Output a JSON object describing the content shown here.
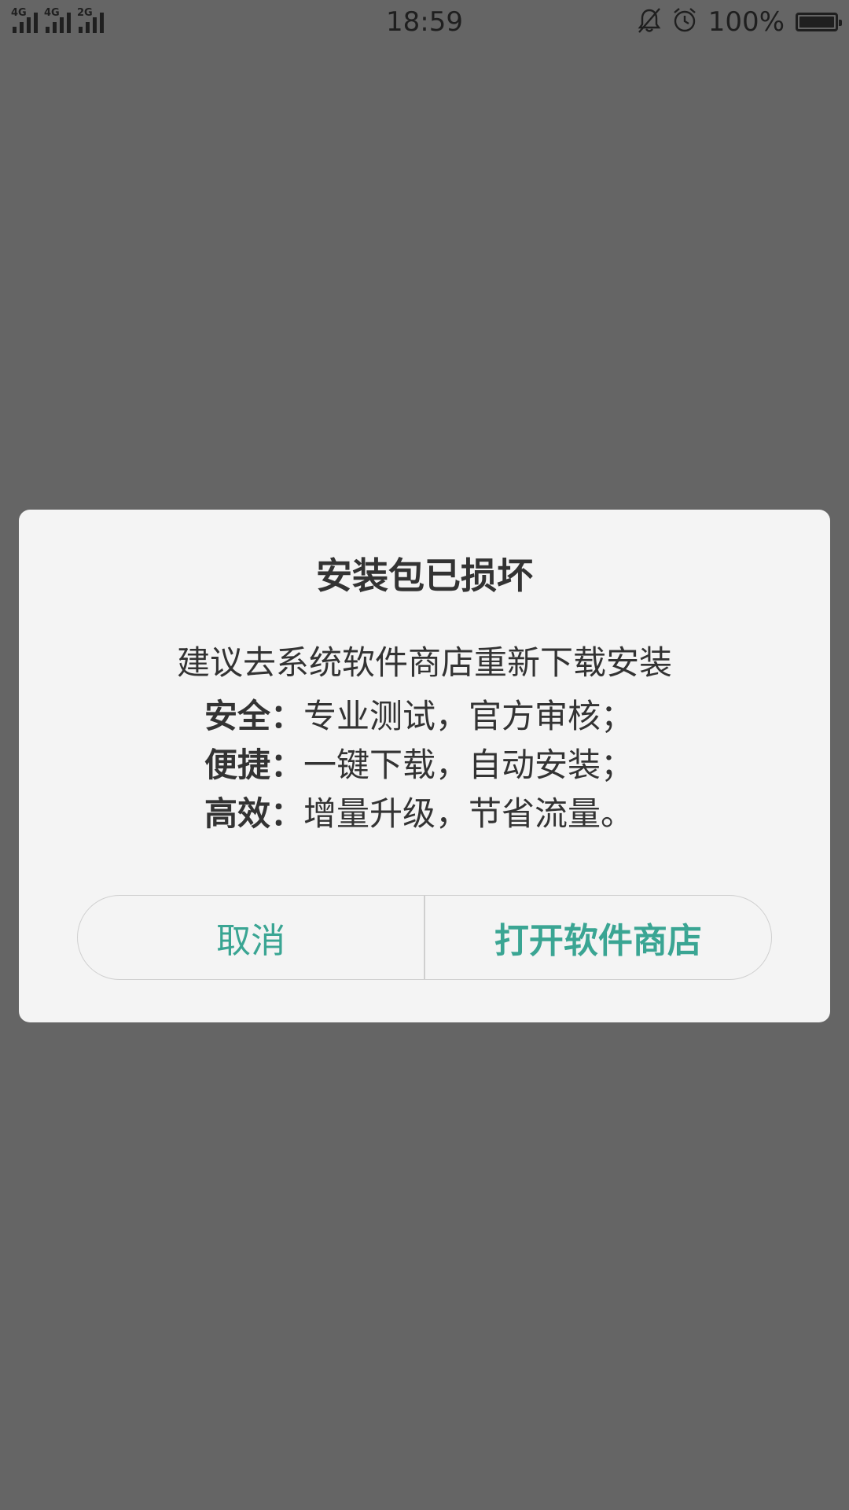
{
  "status_bar": {
    "signal_1_label": "4G",
    "signal_2_label": "4G",
    "signal_3_label": "2G",
    "time": "18:59",
    "mute_icon": "bell-off-icon",
    "alarm_icon": "alarm-clock-icon",
    "battery_text": "100%",
    "battery_level_percent": 100
  },
  "dialog": {
    "title": "安装包已损坏",
    "message": "建议去系统软件商店重新下载安装",
    "features": [
      {
        "label": "安全：",
        "text": "专业测试，官方审核；"
      },
      {
        "label": "便捷：",
        "text": "一键下载，自动安装；"
      },
      {
        "label": "高效：",
        "text": "增量升级，节省流量。"
      }
    ],
    "cancel_label": "取消",
    "open_store_label": "打开软件商店"
  },
  "colors": {
    "overlay": "#656565",
    "dialog_background": "#f4f4f4",
    "accent": "#3aa593",
    "text": "#333333"
  }
}
